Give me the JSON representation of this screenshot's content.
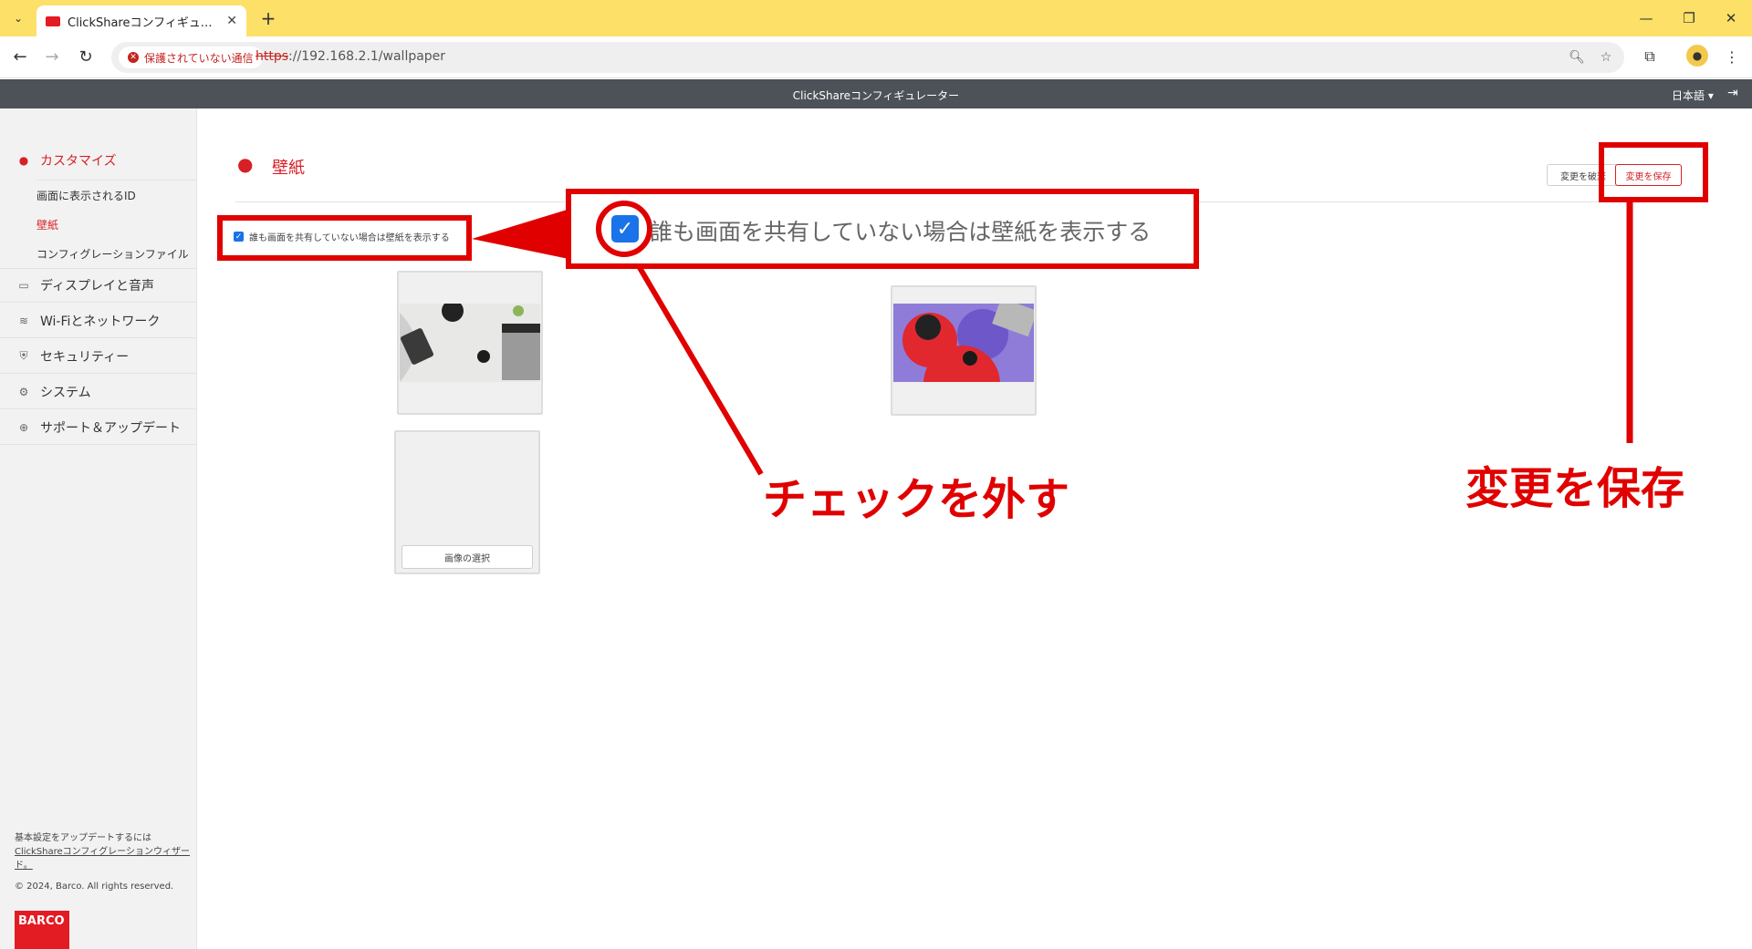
{
  "browser": {
    "tab_title": "ClickShareコンフィギュレーター - 壁紙",
    "tab_close": "✕",
    "new_tab": "+",
    "security_chip": "保護されていない通信",
    "url_protocol": "https",
    "url_rest": "://192.168.2.1/wallpaper",
    "window_minimize": "—",
    "window_restore": "❐",
    "window_close": "✕"
  },
  "app": {
    "title": "ClickShareコンフィギュレーター",
    "language": "日本語 ▾"
  },
  "sidebar": {
    "items": [
      {
        "label": "カスタマイズ",
        "icon": "user-icon",
        "active": true
      },
      {
        "label": "ディスプレイと音声",
        "icon": "monitor-icon"
      },
      {
        "label": "Wi-Fiとネットワーク",
        "icon": "wifi-icon"
      },
      {
        "label": "セキュリティー",
        "icon": "shield-icon"
      },
      {
        "label": "システム",
        "icon": "gear-icon"
      },
      {
        "label": "サポート＆アップデート",
        "icon": "globe-icon"
      }
    ],
    "subitems": [
      {
        "label": "画面に表示されるID"
      },
      {
        "label": "壁紙",
        "active": true
      },
      {
        "label": "コンフィグレーションファイル"
      }
    ],
    "footer_text": "基本設定をアップデートするには",
    "footer_link": "ClickShareコンフィグレーションウィザード。",
    "copyright": "© 2024, Barco. All rights reserved.",
    "logo_text": "BARCO"
  },
  "main": {
    "page_title": "壁紙",
    "discard_button": "変更を破棄",
    "save_button": "変更を保存",
    "checkbox_label": "誰も画面を共有していない場合は壁紙を表示する",
    "checkbox_checked": true,
    "select_image_button": "画像の選択"
  },
  "annotations": {
    "zoom_text": "誰も画面を共有していない場合は壁紙を表示する",
    "uncheck_label": "チェックを外す",
    "save_label": "変更を保存",
    "color": "#e00000"
  },
  "colors": {
    "chrome_tab_bar": "#fde068",
    "app_header": "#4c5257",
    "accent_red": "#d81f26",
    "checkbox_blue": "#1a73e8"
  }
}
